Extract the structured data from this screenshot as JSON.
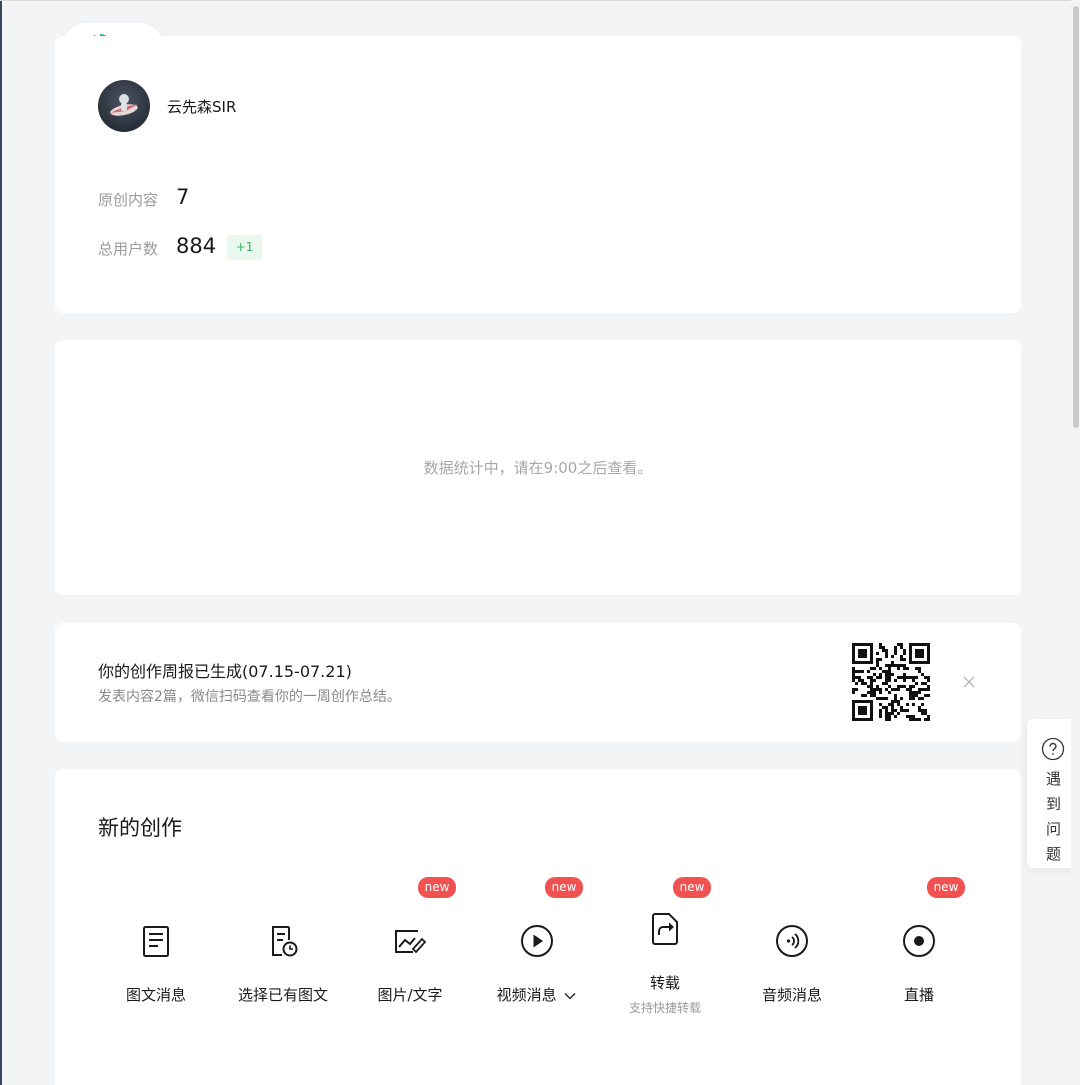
{
  "profile": {
    "username": "云先森SIR",
    "original_content_label": "原创内容",
    "original_content_value": "7",
    "total_users_label": "总用户数",
    "total_users_value": "884",
    "users_growth_badge": "+1"
  },
  "stats": {
    "message": "数据统计中，请在9:00之后查看。"
  },
  "weekly_report": {
    "title": "你的创作周报已生成(07.15-07.21)",
    "description": "发表内容2篇，微信扫码查看你的一周创作总结。"
  },
  "create": {
    "title": "新的创作",
    "new_badge": "new",
    "tools": [
      {
        "label": "图文消息",
        "icon": "document-icon",
        "is_new": false
      },
      {
        "label": "选择已有图文",
        "icon": "document-clock-icon",
        "is_new": false
      },
      {
        "label": "图片/文字",
        "icon": "image-pen-icon",
        "is_new": true
      },
      {
        "label": "视频消息",
        "icon": "play-circle-icon",
        "is_new": true,
        "has_dropdown": true
      },
      {
        "label": "转载",
        "sublabel": "支持快捷转载",
        "icon": "share-doc-icon",
        "is_new": true
      },
      {
        "label": "音频消息",
        "icon": "audio-icon",
        "is_new": false
      },
      {
        "label": "直播",
        "icon": "live-record-icon",
        "is_new": true
      }
    ]
  },
  "help": {
    "label": "遇到问题"
  },
  "colors": {
    "brand_green": "#07c160",
    "new_badge_red": "#f25152",
    "growth_green": "#35b463",
    "page_background": "#f3f4f6"
  }
}
